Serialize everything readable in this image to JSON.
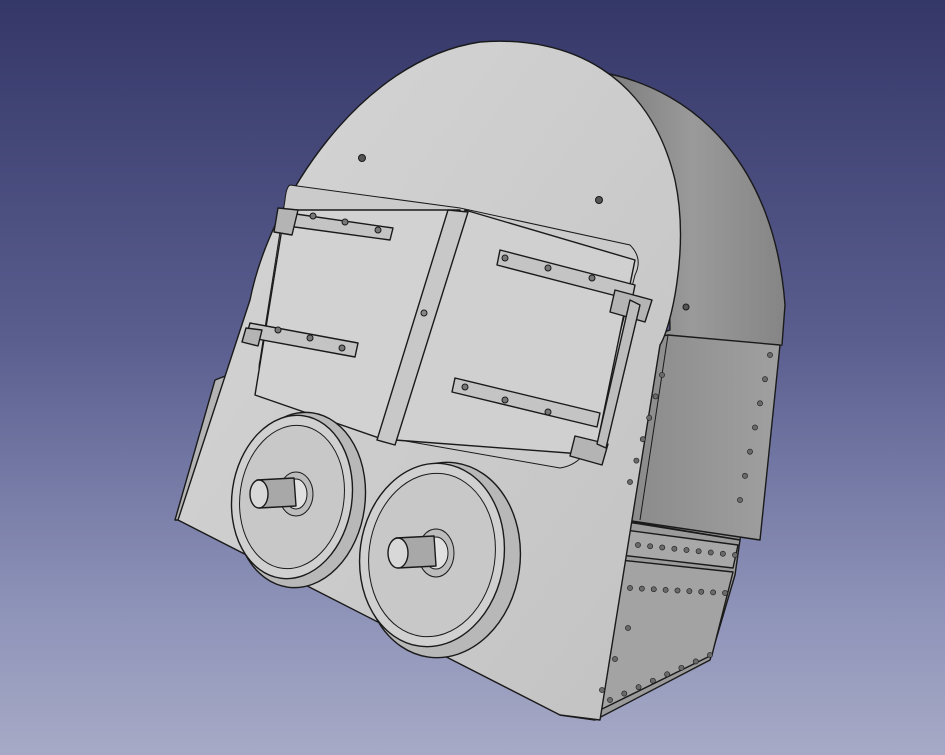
{
  "viewport": {
    "background_top": "#343768",
    "background_bottom": "#a7aac6",
    "model_face_color": "#cfcfcf",
    "model_side_color": "#8e8e8e",
    "model_edge_color": "#1a1a1a"
  },
  "model": {
    "parts": [
      "front-plate",
      "cylindrical-body",
      "firebox-door-left",
      "firebox-door-right",
      "hinge-strap",
      "wheel-left",
      "wheel-right",
      "axle-stub-left",
      "axle-stub-right",
      "side-panel-riveted",
      "lower-box-riveted"
    ]
  }
}
